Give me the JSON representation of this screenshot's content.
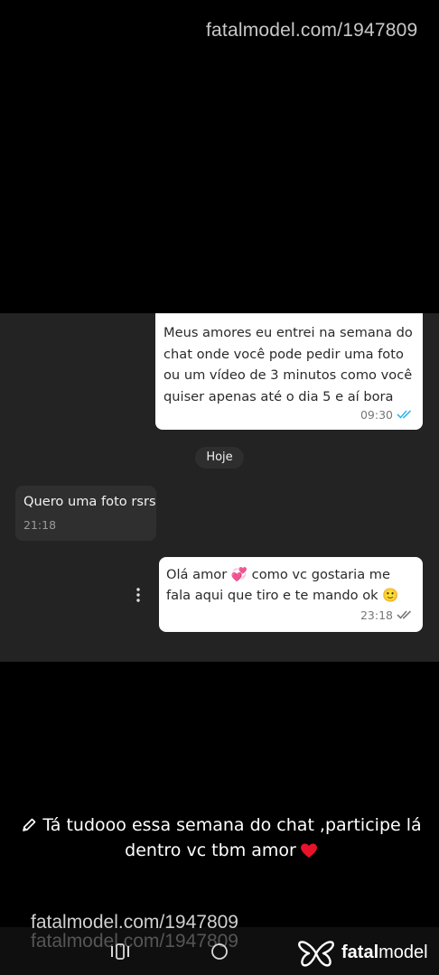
{
  "watermark": {
    "top": "fatalmodel.com/1947809",
    "bottom": "fatalmodel.com/1947809",
    "bottom_ghost": "fatalmodel.com/1947809"
  },
  "chat": {
    "message1": {
      "text": "Meus amores eu entrei na semana do chat onde você pode pedir uma foto ou um vídeo de 3 minutos como você quiser apenas até o dia 5 e aí bora",
      "time": "09:30",
      "status": "read"
    },
    "date_chip": "Hoje",
    "message2": {
      "text": "Quero uma foto rsrs",
      "time": "21:18"
    },
    "message3": {
      "text_before": "Olá amor",
      "emoji1": "💞",
      "text_after": "como vc gostaria me fala aqui que tiro e te mando ok",
      "emoji2": "🙂",
      "time": "23:18",
      "status": "delivered"
    }
  },
  "caption": {
    "line": "Tá tudooo essa semana do chat ,participe lá dentro vc tbm amor",
    "icon": "pencil-icon",
    "heart": "heart-icon"
  },
  "brand": {
    "logo_text_bold": "fatal",
    "logo_text_light": "model",
    "accent": "#ffffff"
  },
  "colors": {
    "read_ticks": "#34b7f1",
    "chat_bg": "#232323",
    "sent_bubble": "#ffffff"
  }
}
